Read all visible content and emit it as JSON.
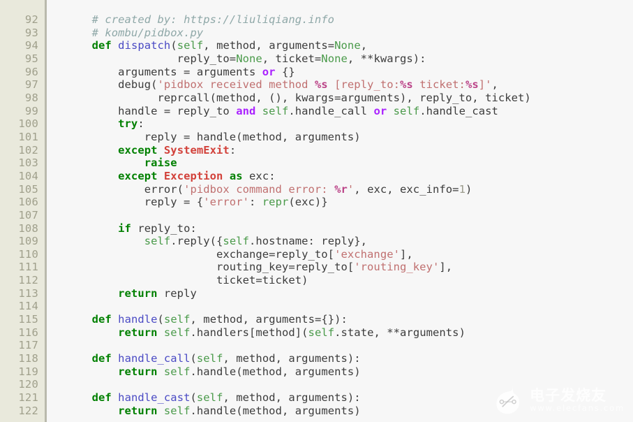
{
  "editor": {
    "language": "python",
    "background": "#f7f7f7",
    "gutter_background": "#e9e9dc",
    "gutter_text_color": "#a0a08c",
    "first_line_number": 92,
    "last_line_number": 122,
    "line_numbers": [
      92,
      93,
      94,
      95,
      96,
      97,
      98,
      99,
      100,
      101,
      102,
      103,
      104,
      105,
      106,
      107,
      108,
      109,
      110,
      111,
      112,
      113,
      114,
      115,
      116,
      117,
      118,
      119,
      120,
      121,
      122
    ]
  },
  "palette": {
    "plain": "#3c3c3c",
    "comment": "#8fa8a8",
    "keyword": "#008000",
    "operator_word": "#aa22ff",
    "function_name": "#4a4ac4",
    "builtin": "#4a9a4a",
    "exception": "#d2413a",
    "string": "#c07070",
    "string_format": "#bb4488",
    "number": "#9a9a8c"
  },
  "code_lines": [
    {
      "n": 92,
      "text": "    # created by: https://liuliqiang.info",
      "tokens": [
        {
          "t": "    ",
          "c": "plain"
        },
        {
          "t": "# created by: https://liuliqiang.info",
          "c": "comment"
        }
      ]
    },
    {
      "n": 93,
      "text": "    # kombu/pidbox.py",
      "tokens": [
        {
          "t": "    ",
          "c": "plain"
        },
        {
          "t": "# kombu/pidbox.py",
          "c": "comment"
        }
      ]
    },
    {
      "n": 94,
      "text": "    def dispatch(self, method, arguments=None,",
      "tokens": [
        {
          "t": "    ",
          "c": "plain"
        },
        {
          "t": "def",
          "c": "kw"
        },
        {
          "t": " ",
          "c": "plain"
        },
        {
          "t": "dispatch",
          "c": "fn"
        },
        {
          "t": "(",
          "c": "plain"
        },
        {
          "t": "self",
          "c": "self"
        },
        {
          "t": ", method, arguments=",
          "c": "plain"
        },
        {
          "t": "None",
          "c": "builtin"
        },
        {
          "t": ",",
          "c": "plain"
        }
      ]
    },
    {
      "n": 95,
      "text": "                 reply_to=None, ticket=None, **kwargs):",
      "tokens": [
        {
          "t": "                 reply_to=",
          "c": "plain"
        },
        {
          "t": "None",
          "c": "builtin"
        },
        {
          "t": ", ticket=",
          "c": "plain"
        },
        {
          "t": "None",
          "c": "builtin"
        },
        {
          "t": ", **kwargs):",
          "c": "plain"
        }
      ]
    },
    {
      "n": 96,
      "text": "        arguments = arguments or {}",
      "tokens": [
        {
          "t": "        arguments = arguments ",
          "c": "plain"
        },
        {
          "t": "or",
          "c": "op"
        },
        {
          "t": " {}",
          "c": "plain"
        }
      ]
    },
    {
      "n": 97,
      "text": "        debug('pidbox received method %s [reply_to:%s ticket:%s]',",
      "tokens": [
        {
          "t": "        debug(",
          "c": "plain"
        },
        {
          "t": "'pidbox received method ",
          "c": "str"
        },
        {
          "t": "%s",
          "c": "fmt"
        },
        {
          "t": " [reply_to:",
          "c": "str"
        },
        {
          "t": "%s",
          "c": "fmt"
        },
        {
          "t": " ticket:",
          "c": "str"
        },
        {
          "t": "%s",
          "c": "fmt"
        },
        {
          "t": "]'",
          "c": "str"
        },
        {
          "t": ",",
          "c": "plain"
        }
      ]
    },
    {
      "n": 98,
      "text": "              reprcall(method, (), kwargs=arguments), reply_to, ticket)",
      "tokens": [
        {
          "t": "              reprcall(method, (), kwargs=arguments), reply_to, ticket)",
          "c": "plain"
        }
      ]
    },
    {
      "n": 99,
      "text": "        handle = reply_to and self.handle_call or self.handle_cast",
      "tokens": [
        {
          "t": "        handle = reply_to ",
          "c": "plain"
        },
        {
          "t": "and",
          "c": "op"
        },
        {
          "t": " ",
          "c": "plain"
        },
        {
          "t": "self",
          "c": "self"
        },
        {
          "t": ".handle_call ",
          "c": "plain"
        },
        {
          "t": "or",
          "c": "op"
        },
        {
          "t": " ",
          "c": "plain"
        },
        {
          "t": "self",
          "c": "self"
        },
        {
          "t": ".handle_cast",
          "c": "plain"
        }
      ]
    },
    {
      "n": 100,
      "text": "        try:",
      "tokens": [
        {
          "t": "        ",
          "c": "plain"
        },
        {
          "t": "try",
          "c": "kw"
        },
        {
          "t": ":",
          "c": "plain"
        }
      ]
    },
    {
      "n": 101,
      "text": "            reply = handle(method, arguments)",
      "tokens": [
        {
          "t": "            reply = handle(method, arguments)",
          "c": "plain"
        }
      ]
    },
    {
      "n": 102,
      "text": "        except SystemExit:",
      "tokens": [
        {
          "t": "        ",
          "c": "plain"
        },
        {
          "t": "except",
          "c": "kw"
        },
        {
          "t": " ",
          "c": "plain"
        },
        {
          "t": "SystemExit",
          "c": "exc"
        },
        {
          "t": ":",
          "c": "plain"
        }
      ]
    },
    {
      "n": 103,
      "text": "            raise",
      "tokens": [
        {
          "t": "            ",
          "c": "plain"
        },
        {
          "t": "raise",
          "c": "kw"
        }
      ]
    },
    {
      "n": 104,
      "text": "        except Exception as exc:",
      "tokens": [
        {
          "t": "        ",
          "c": "plain"
        },
        {
          "t": "except",
          "c": "kw"
        },
        {
          "t": " ",
          "c": "plain"
        },
        {
          "t": "Exception",
          "c": "exc"
        },
        {
          "t": " ",
          "c": "plain"
        },
        {
          "t": "as",
          "c": "kw"
        },
        {
          "t": " exc:",
          "c": "plain"
        }
      ]
    },
    {
      "n": 105,
      "text": "            error('pidbox command error: %r', exc, exc_info=1)",
      "tokens": [
        {
          "t": "            error(",
          "c": "plain"
        },
        {
          "t": "'pidbox command error: ",
          "c": "str"
        },
        {
          "t": "%r",
          "c": "fmt"
        },
        {
          "t": "'",
          "c": "str"
        },
        {
          "t": ", exc, exc_info=",
          "c": "plain"
        },
        {
          "t": "1",
          "c": "num"
        },
        {
          "t": ")",
          "c": "plain"
        }
      ]
    },
    {
      "n": 106,
      "text": "            reply = {'error': repr(exc)}",
      "tokens": [
        {
          "t": "            reply = {",
          "c": "plain"
        },
        {
          "t": "'error'",
          "c": "str"
        },
        {
          "t": ": ",
          "c": "plain"
        },
        {
          "t": "repr",
          "c": "builtin"
        },
        {
          "t": "(exc)}",
          "c": "plain"
        }
      ]
    },
    {
      "n": 107,
      "text": "",
      "tokens": []
    },
    {
      "n": 108,
      "text": "        if reply_to:",
      "tokens": [
        {
          "t": "        ",
          "c": "plain"
        },
        {
          "t": "if",
          "c": "kw"
        },
        {
          "t": " reply_to:",
          "c": "plain"
        }
      ]
    },
    {
      "n": 109,
      "text": "            self.reply({self.hostname: reply},",
      "tokens": [
        {
          "t": "            ",
          "c": "plain"
        },
        {
          "t": "self",
          "c": "self"
        },
        {
          "t": ".reply({",
          "c": "plain"
        },
        {
          "t": "self",
          "c": "self"
        },
        {
          "t": ".hostname: reply},",
          "c": "plain"
        }
      ]
    },
    {
      "n": 110,
      "text": "                       exchange=reply_to['exchange'],",
      "tokens": [
        {
          "t": "                       exchange=reply_to[",
          "c": "plain"
        },
        {
          "t": "'exchange'",
          "c": "str"
        },
        {
          "t": "],",
          "c": "plain"
        }
      ]
    },
    {
      "n": 111,
      "text": "                       routing_key=reply_to['routing_key'],",
      "tokens": [
        {
          "t": "                       routing_key=reply_to[",
          "c": "plain"
        },
        {
          "t": "'routing_key'",
          "c": "str"
        },
        {
          "t": "],",
          "c": "plain"
        }
      ]
    },
    {
      "n": 112,
      "text": "                       ticket=ticket)",
      "tokens": [
        {
          "t": "                       ticket=ticket)",
          "c": "plain"
        }
      ]
    },
    {
      "n": 113,
      "text": "        return reply",
      "tokens": [
        {
          "t": "        ",
          "c": "plain"
        },
        {
          "t": "return",
          "c": "kw"
        },
        {
          "t": " reply",
          "c": "plain"
        }
      ]
    },
    {
      "n": 114,
      "text": "",
      "tokens": []
    },
    {
      "n": 115,
      "text": "    def handle(self, method, arguments={}):",
      "tokens": [
        {
          "t": "    ",
          "c": "plain"
        },
        {
          "t": "def",
          "c": "kw"
        },
        {
          "t": " ",
          "c": "plain"
        },
        {
          "t": "handle",
          "c": "fn"
        },
        {
          "t": "(",
          "c": "plain"
        },
        {
          "t": "self",
          "c": "self"
        },
        {
          "t": ", method, arguments={}):",
          "c": "plain"
        }
      ]
    },
    {
      "n": 116,
      "text": "        return self.handlers[method](self.state, **arguments)",
      "tokens": [
        {
          "t": "        ",
          "c": "plain"
        },
        {
          "t": "return",
          "c": "kw"
        },
        {
          "t": " ",
          "c": "plain"
        },
        {
          "t": "self",
          "c": "self"
        },
        {
          "t": ".handlers[method](",
          "c": "plain"
        },
        {
          "t": "self",
          "c": "self"
        },
        {
          "t": ".state, **arguments)",
          "c": "plain"
        }
      ]
    },
    {
      "n": 117,
      "text": "",
      "tokens": []
    },
    {
      "n": 118,
      "text": "    def handle_call(self, method, arguments):",
      "tokens": [
        {
          "t": "    ",
          "c": "plain"
        },
        {
          "t": "def",
          "c": "kw"
        },
        {
          "t": " ",
          "c": "plain"
        },
        {
          "t": "handle_call",
          "c": "fn"
        },
        {
          "t": "(",
          "c": "plain"
        },
        {
          "t": "self",
          "c": "self"
        },
        {
          "t": ", method, arguments):",
          "c": "plain"
        }
      ]
    },
    {
      "n": 119,
      "text": "        return self.handle(method, arguments)",
      "tokens": [
        {
          "t": "        ",
          "c": "plain"
        },
        {
          "t": "return",
          "c": "kw"
        },
        {
          "t": " ",
          "c": "plain"
        },
        {
          "t": "self",
          "c": "self"
        },
        {
          "t": ".handle(method, arguments)",
          "c": "plain"
        }
      ]
    },
    {
      "n": 120,
      "text": "",
      "tokens": []
    },
    {
      "n": 121,
      "text": "    def handle_cast(self, method, arguments):",
      "tokens": [
        {
          "t": "    ",
          "c": "plain"
        },
        {
          "t": "def",
          "c": "kw"
        },
        {
          "t": " ",
          "c": "plain"
        },
        {
          "t": "handle_cast",
          "c": "fn"
        },
        {
          "t": "(",
          "c": "plain"
        },
        {
          "t": "self",
          "c": "self"
        },
        {
          "t": ", method, arguments):",
          "c": "plain"
        }
      ]
    },
    {
      "n": 122,
      "text": "        return self.handle(method, arguments)",
      "tokens": [
        {
          "t": "        ",
          "c": "plain"
        },
        {
          "t": "return",
          "c": "kw"
        },
        {
          "t": " ",
          "c": "plain"
        },
        {
          "t": "self",
          "c": "self"
        },
        {
          "t": ".handle(method, arguments)",
          "c": "plain"
        }
      ]
    }
  ],
  "watermark": {
    "cn_text": "电子发烧友",
    "url_text": "www.elecfans.com",
    "logo_icon": "circuit-circle-icon",
    "color": "#ffffff"
  }
}
